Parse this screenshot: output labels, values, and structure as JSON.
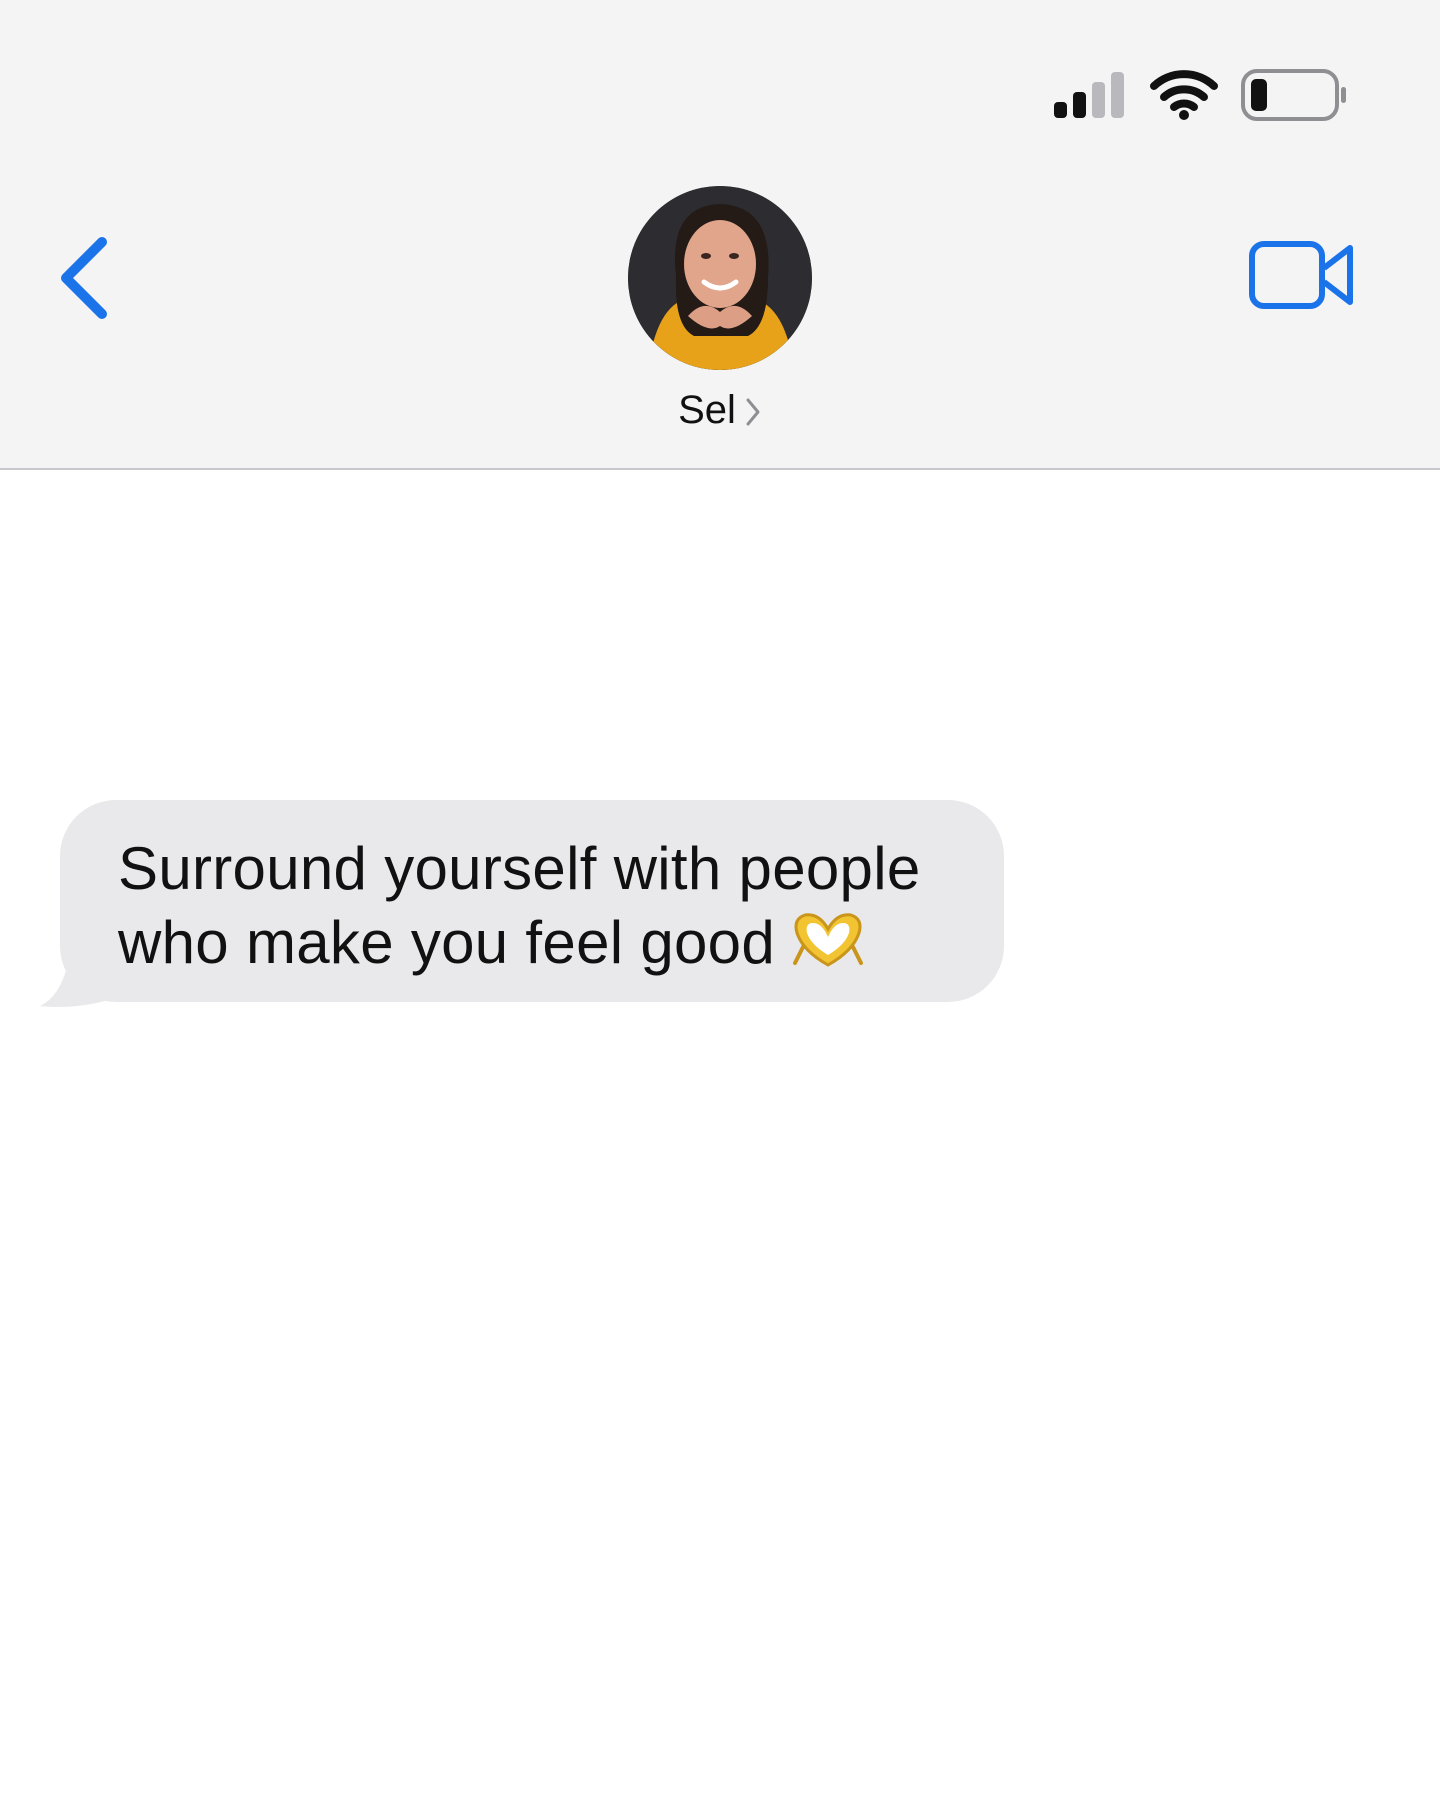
{
  "status_bar": {
    "signal_icon": "cellular-signal-icon",
    "wifi_icon": "wifi-icon",
    "battery_icon": "battery-low-icon",
    "signal_bars_active": 2,
    "signal_bars_total": 4,
    "battery_level": 0.15
  },
  "header": {
    "back_icon": "chevron-left-icon",
    "video_icon": "video-camera-icon",
    "contact": {
      "name": "Sel",
      "chevron_icon": "chevron-right-icon",
      "avatar": "contact-photo"
    }
  },
  "conversation": {
    "messages": [
      {
        "direction": "incoming",
        "line1": "Surround yourself with people",
        "line2": "who make you feel good",
        "emoji": "heart-hands-emoji"
      }
    ]
  },
  "colors": {
    "accent": "#1a73e8",
    "header_bg": "#f4f4f5",
    "bubble_incoming": "#e9e9eb",
    "text": "#111111"
  }
}
